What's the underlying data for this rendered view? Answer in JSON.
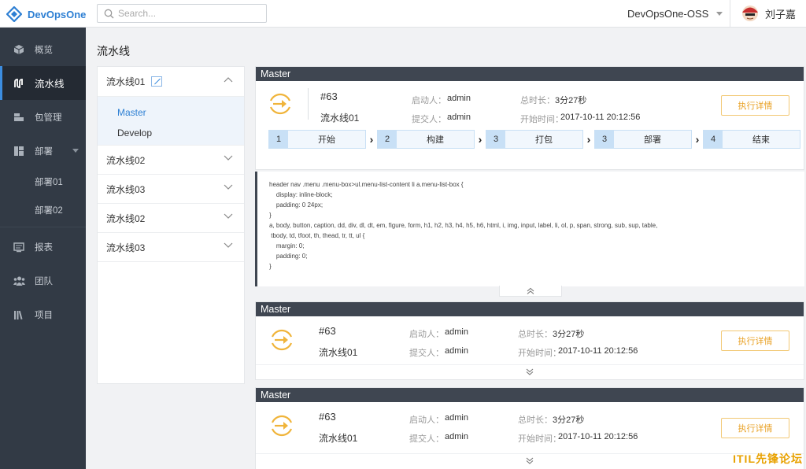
{
  "topbar": {
    "logo_text": "DevOpsOne",
    "search_placeholder": "Search...",
    "org_name": "DevOpsOne-OSS",
    "user_name": "刘子嘉"
  },
  "sidebar": {
    "items": [
      {
        "label": "概览",
        "icon": "cube-icon"
      },
      {
        "label": "流水线",
        "icon": "pipeline-icon",
        "active": true
      },
      {
        "label": "包管理",
        "icon": "package-icon"
      },
      {
        "label": "部署",
        "icon": "deploy-icon"
      },
      {
        "label": "部署01"
      },
      {
        "label": "部署02"
      },
      {
        "label": "报表",
        "icon": "report-icon"
      },
      {
        "label": "团队",
        "icon": "team-icon"
      },
      {
        "label": "项目",
        "icon": "project-icon"
      }
    ]
  },
  "main": {
    "title": "流水线",
    "pipelines": [
      {
        "label": "流水线01",
        "branches": [
          "Master",
          "Develop"
        ]
      },
      {
        "label": "流水线02"
      },
      {
        "label": "流水线03"
      },
      {
        "label": "流水线02"
      },
      {
        "label": "流水线03"
      }
    ]
  },
  "runs": [
    {
      "branch": "Master",
      "id": "#63",
      "pipeline": "流水线01",
      "starter_label": "启动人：",
      "starter": "admin",
      "submitter_label": "提交人：",
      "submitter": "admin",
      "duration_label": "总时长：",
      "duration": "3分27秒",
      "start_label": "开始时间：",
      "start_time": "2017-10-11  20:12:56",
      "detail_label": "执行详情"
    },
    {
      "branch": "Master",
      "id": "#63",
      "pipeline": "流水线01",
      "starter_label": "启动人：",
      "starter": "admin",
      "submitter_label": "提交人：",
      "submitter": "admin",
      "duration_label": "总时长：",
      "duration": "3分27秒",
      "start_label": "开始时间：",
      "start_time": "2017-10-11  20:12:56",
      "detail_label": "执行详情"
    },
    {
      "branch": "Master",
      "id": "#63",
      "pipeline": "流水线01",
      "starter_label": "启动人：",
      "starter": "admin",
      "submitter_label": "提交人：",
      "submitter": "admin",
      "duration_label": "总时长：",
      "duration": "3分27秒",
      "start_label": "开始时间：",
      "start_time": "2017-10-11  20:12:56",
      "detail_label": "执行详情"
    }
  ],
  "stages": [
    {
      "num": "1",
      "name": "开始"
    },
    {
      "num": "2",
      "name": "构建"
    },
    {
      "num": "3",
      "name": "打包"
    },
    {
      "num": "3",
      "name": "部署"
    },
    {
      "num": "4",
      "name": "结束"
    }
  ],
  "log_lines": [
    "header nav .menu .menu-box>ul.menu-list-content li a.menu-list-box {",
    "    display: inline-block;",
    "    padding: 0 24px;",
    "}",
    "a, body, button, caption, dd, div, dl, dt, em, figure, form, h1, h2, h3, h4, h5, h6, html, i, img, input, label, li, ol, p, span, strong, sub, sup, table,",
    " tbody, td, tfoot, th, thead, tr, tt, ul {",
    "    margin: 0;",
    "    padding: 0;",
    "}"
  ],
  "watermark": "ITIL先锋论坛"
}
